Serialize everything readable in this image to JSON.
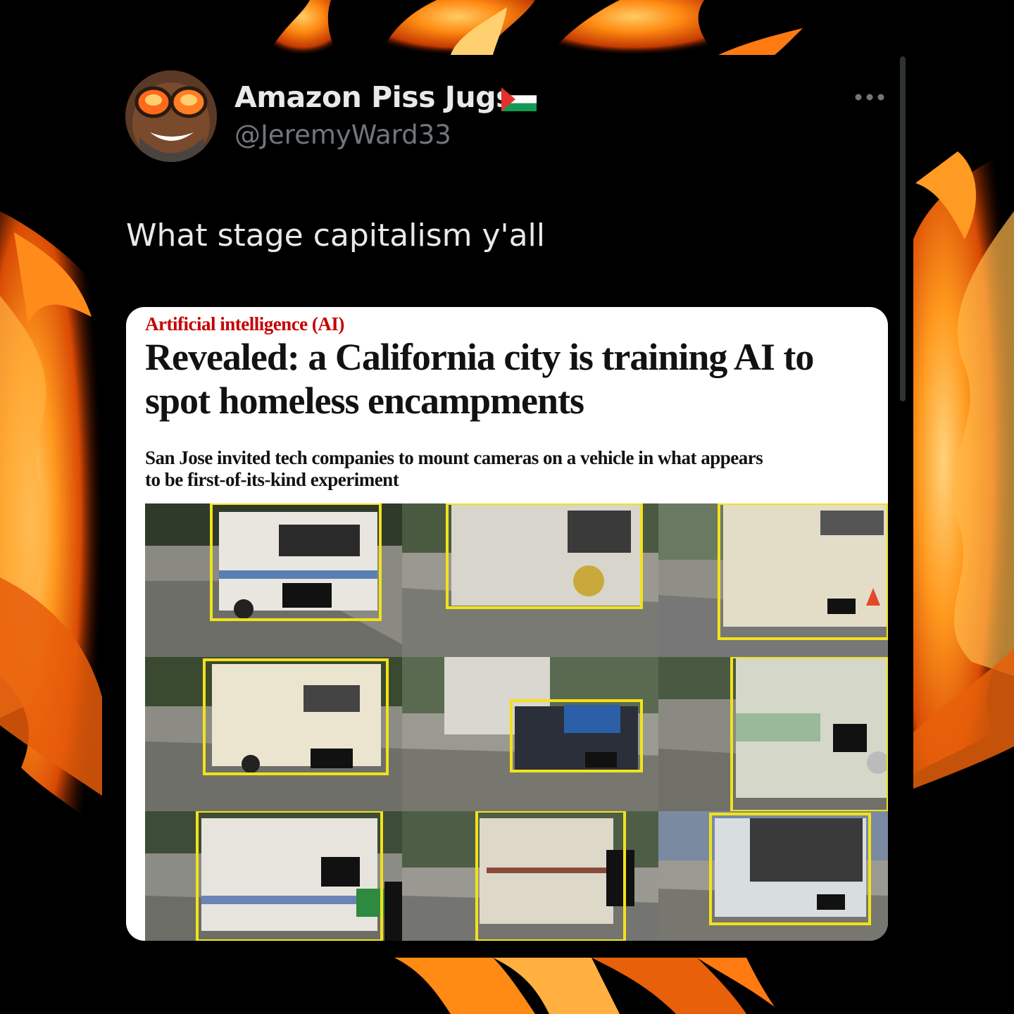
{
  "tweet": {
    "display_name": "Amazon Piss Jugs",
    "handle": "@JeremyWard33",
    "text": "What stage capitalism y'all",
    "flag_icon": "palestine-flag-icon",
    "more_icon": "more-options-icon"
  },
  "article": {
    "kicker": "Artificial intelligence (AI)",
    "headline": "Revealed: a California city is training AI to spot homeless encampments",
    "standfirst": "San Jose invited tech companies to mount cameras on a vehicle in what appears to be first-of-its-kind experiment"
  },
  "colors": {
    "accent_red": "#c70000",
    "detection_box": "#f2e21a",
    "fire_orange": "#ff7a10"
  }
}
